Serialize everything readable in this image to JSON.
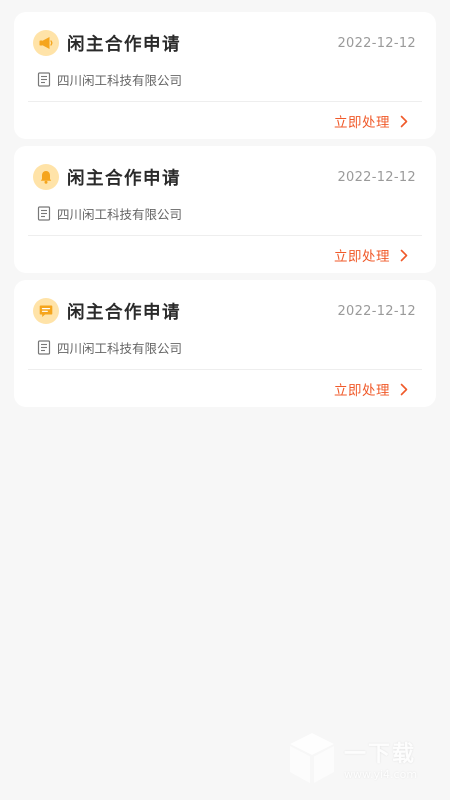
{
  "colors": {
    "background": "#f7f7f7",
    "card": "#ffffff",
    "accent": "#f05a2a",
    "icon_bg": "#ffe3a8",
    "icon_fg": "#f5a51d"
  },
  "notifications": [
    {
      "icon": "megaphone-icon",
      "title": "闲主合作申请",
      "date": "2022-12-12",
      "company": "四川闲工科技有限公司",
      "action_label": "立即处理"
    },
    {
      "icon": "bell-icon",
      "title": "闲主合作申请",
      "date": "2022-12-12",
      "company": "四川闲工科技有限公司",
      "action_label": "立即处理"
    },
    {
      "icon": "message-icon",
      "title": "闲主合作申请",
      "date": "2022-12-12",
      "company": "四川闲工科技有限公司",
      "action_label": "立即处理"
    }
  ],
  "watermark": {
    "brand": "一下载",
    "url": "www.yi4.com"
  }
}
